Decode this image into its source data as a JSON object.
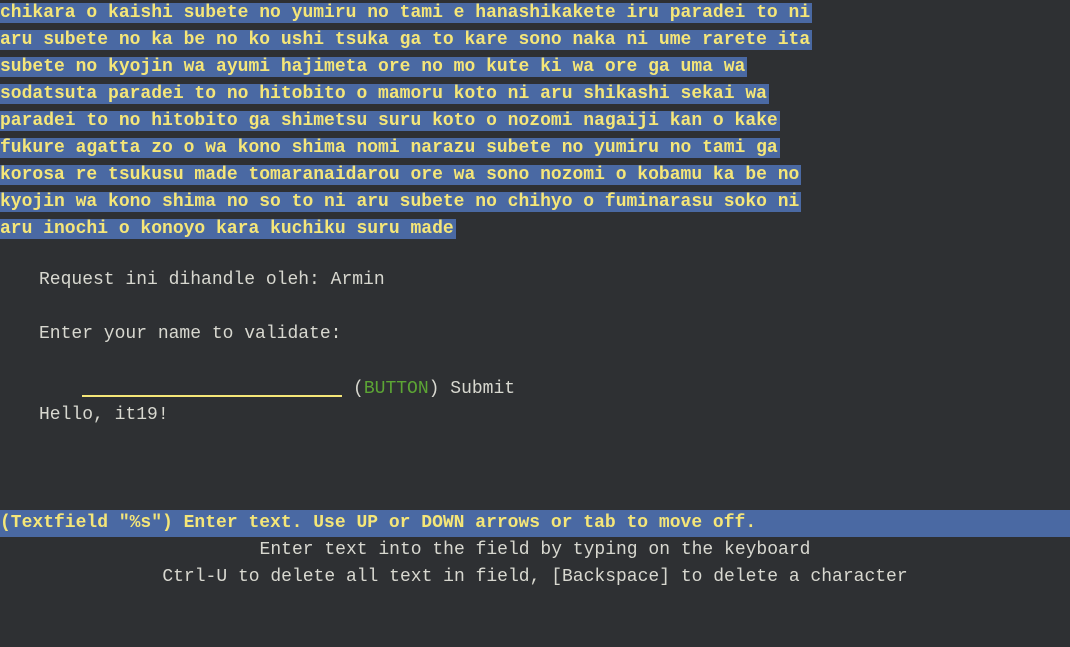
{
  "banner_lines": [
    "chikara o kaishi subete no yumiru no tami e hanashikakete iru paradei to ni",
    "aru subete no ka be no ko ushi tsuka ga to kare sono naka ni ume rarete ita",
    "subete no kyojin wa ayumi hajimeta ore no mo kute ki wa ore ga uma wa",
    "sodatsuta paradei to no hitobito o mamoru koto ni aru shikashi sekai wa",
    "paradei to no hitobito ga shimetsu suru koto o nozomi nagaiji kan o kake",
    "fukure agatta zo o wa kono shima nomi narazu subete no yumiru no tami ga",
    "korosa re tsukusu made tomaranaidarou ore wa sono nozomi o kobamu ka be no",
    "kyojin wa kono shima no so to ni aru subete no chihyo o fuminarasu soko ni",
    "aru inochi o konoyo kara kuchiku suru made"
  ],
  "request_text": "Request ini dihandle oleh: Armin",
  "prompt_text": "Enter your name to validate:",
  "name_input": {
    "value": "",
    "placeholder": ""
  },
  "button": {
    "open": "(",
    "tag": "BUTTON",
    "close": ")",
    "label": "Submit"
  },
  "greeting": "Hello, it19!",
  "status_bar": "(Textfield \"%s\") Enter text. Use UP or DOWN arrows or tab to move off.",
  "help_lines": [
    "Enter text into the field by typing on the keyboard",
    "Ctrl-U to delete all text in field, [Backspace] to delete a character"
  ]
}
